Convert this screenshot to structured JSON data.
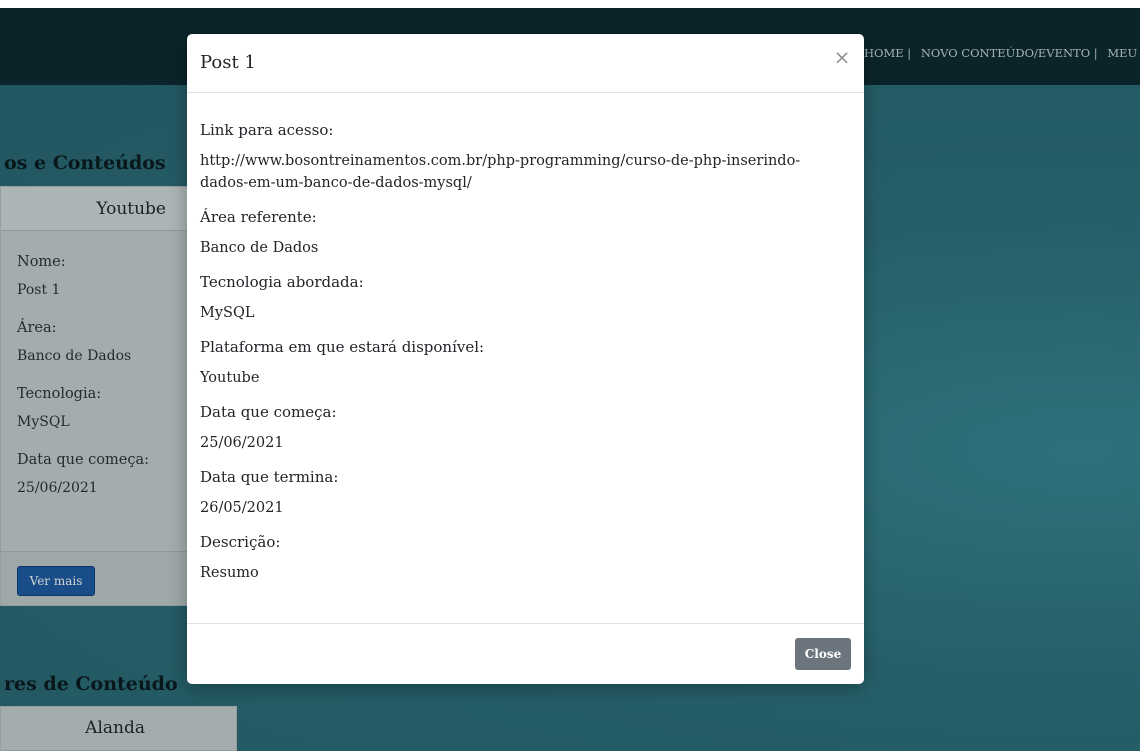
{
  "navbar": {
    "links": [
      "HOME |",
      "NOVO CONTEÚDO/EVENTO |",
      "MEU PE"
    ]
  },
  "background": {
    "section1_title": "os e Conteúdos",
    "section2_title": "res de Conteúdo",
    "card": {
      "header": "Youtube",
      "fields": [
        {
          "label": "Nome:",
          "value": "Post 1"
        },
        {
          "label": "Área:",
          "value": "Banco de Dados"
        },
        {
          "label": "Tecnologia:",
          "value": "MySQL"
        },
        {
          "label": "Data que começa:",
          "value": "25/06/2021"
        }
      ],
      "button": "Ver mais"
    },
    "card2": {
      "header": "Alanda"
    }
  },
  "modal": {
    "title": "Post 1",
    "close_icon": "×",
    "fields": [
      {
        "label": "Link para acesso:",
        "value": "http://www.bosontreinamentos.com.br/php-programming/curso-de-php-inserindo-dados-em-um-banco-de-dados-mysql/"
      },
      {
        "label": "Área referente:",
        "value": "Banco de Dados"
      },
      {
        "label": "Tecnologia abordada:",
        "value": "MySQL"
      },
      {
        "label": "Plataforma em que estará disponível:",
        "value": "Youtube"
      },
      {
        "label": "Data que começa:",
        "value": "25/06/2021"
      },
      {
        "label": "Data que termina:",
        "value": "26/05/2021"
      },
      {
        "label": "Descrição:",
        "value": "Resumo"
      }
    ],
    "close_button": "Close"
  },
  "colors": {
    "navbar": "#0e2c33",
    "background": "#2f7480",
    "primary_button": "#1e5fa8",
    "secondary_button": "#6c757d"
  }
}
